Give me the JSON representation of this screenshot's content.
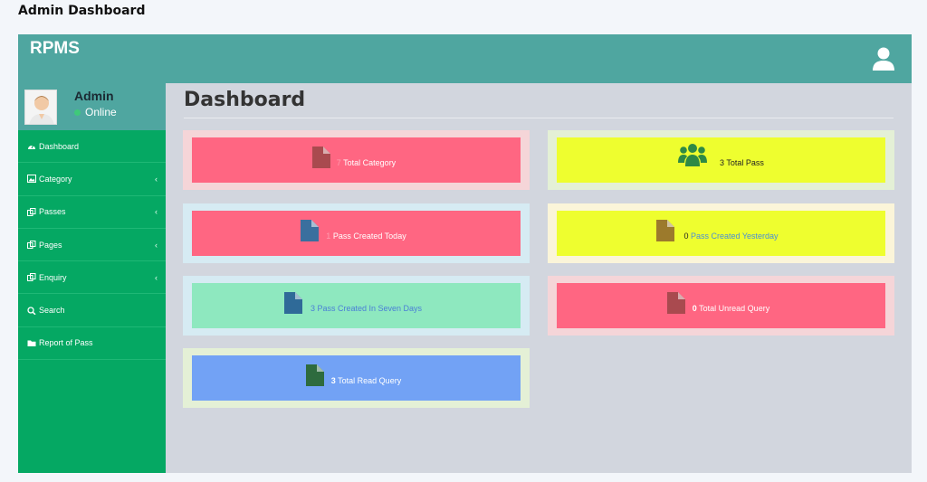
{
  "page_heading": "Admin Dashboard",
  "app": {
    "brand": "RPMS"
  },
  "user": {
    "name": "Admin",
    "status": "Online"
  },
  "menu": [
    {
      "label": "Dashboard",
      "icon": "dashboard-icon",
      "has_submenu": false
    },
    {
      "label": "Category",
      "icon": "image-icon",
      "has_submenu": true
    },
    {
      "label": "Passes",
      "icon": "copy-icon",
      "has_submenu": true
    },
    {
      "label": "Pages",
      "icon": "copy-icon",
      "has_submenu": true
    },
    {
      "label": "Enquiry",
      "icon": "copy-icon",
      "has_submenu": true
    },
    {
      "label": "Search",
      "icon": "search-icon",
      "has_submenu": false
    },
    {
      "label": "Report of Pass",
      "icon": "folder-icon",
      "has_submenu": false
    }
  ],
  "content": {
    "title": "Dashboard"
  },
  "cards": [
    {
      "count": "7",
      "label": "Total Category",
      "icon": "file-icon",
      "bg": "#ff6682",
      "frame": "#f5d5d8",
      "icon_color": "#a94a4f",
      "count_color": "#ff9db0",
      "label_color": "#ffffff"
    },
    {
      "count": "3",
      "label": "Total Pass",
      "icon": "users-icon",
      "bg": "#eefe2f",
      "frame": "#e4f0d6",
      "icon_color": "#2e8a45",
      "count_color": "#222222",
      "label_color": "#222222"
    },
    {
      "count": "1",
      "label": "Pass Created Today",
      "icon": "file-icon",
      "bg": "#ff6682",
      "frame": "#d6ebf3",
      "icon_color": "#3a6f9e",
      "count_color": "#ff9db0",
      "label_color": "#ffffff"
    },
    {
      "count": "0",
      "label": "Pass Created Yesterday",
      "icon": "file-icon",
      "bg": "#eefe2f",
      "frame": "#fbf5d9",
      "icon_color": "#9c7a2c",
      "count_color": "#222222",
      "label_color": "#4a8fd6"
    },
    {
      "count": "3",
      "label": "Pass Created In Seven Days",
      "icon": "file-icon",
      "bg": "#8ee8bf",
      "frame": "#d6ebf3",
      "icon_color": "#2f6a98",
      "count_color": "#4a7fd6",
      "label_color": "#4a7fd6"
    },
    {
      "count": "0",
      "label": "Total Unread Query",
      "icon": "file-icon",
      "bg": "#ff6682",
      "frame": "#f5d5d8",
      "icon_color": "#a94a4f",
      "count_color": "#ffffff",
      "label_color": "#ffffff"
    },
    {
      "count": "3",
      "label": "Total Read Query",
      "icon": "file-icon",
      "bg": "#72a2f5",
      "frame": "#e4f0d6",
      "icon_color": "#2e6b3e",
      "count_color": "#ffffff",
      "label_color": "#ffffff"
    }
  ]
}
